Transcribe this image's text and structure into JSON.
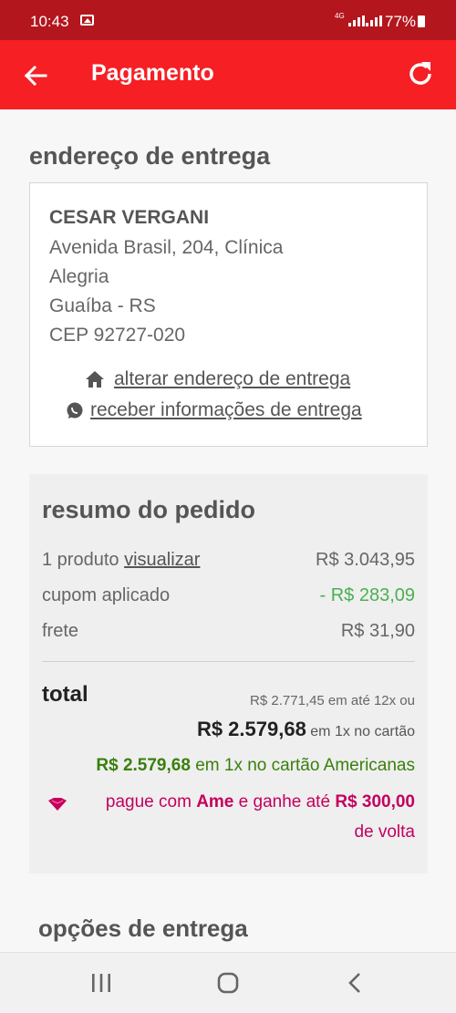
{
  "status_bar": {
    "time": "10:43",
    "network": "4G",
    "battery": "77%"
  },
  "app_bar": {
    "title": "Pagamento"
  },
  "delivery_address": {
    "section_title": "endereço de entrega",
    "name": "CESAR VERGANI",
    "lines": [
      "Avenida Brasil, 204, Clínica",
      "Alegria",
      "Guaíba - RS",
      "CEP 92727-020"
    ],
    "change_address_link": "alterar endereço de entrega",
    "delivery_info_link": "receber informações de entrega"
  },
  "order_summary": {
    "section_title": "resumo do pedido",
    "products_label": "1 produto",
    "view_link": "visualizar",
    "products_value": "R$ 3.043,95",
    "coupon_label": "cupom aplicado",
    "coupon_value": "- R$ 283,09",
    "shipping_label": "frete",
    "shipping_value": "R$ 31,90",
    "total_label": "total",
    "installments": "R$ 2.771,45 em até 12x ou",
    "total_amount": "R$ 2.579,68",
    "total_suffix": "em 1x no cartão",
    "americanas_amount": "R$ 2.579,68",
    "americanas_suffix": "em 1x no cartão Americanas",
    "ame_prefix": "pague com",
    "ame_brand": "Ame",
    "ame_middle": "e ganhe até",
    "ame_amount": "R$ 300,00",
    "ame_suffix": "de volta"
  },
  "delivery_options": {
    "section_title": "opções de entrega"
  },
  "colors": {
    "status_bar": "#b3161c",
    "app_bar": "#f51f24",
    "discount_green": "#4caf50",
    "americanas_green": "#3a7f0c",
    "ame_pink": "#c4005d"
  }
}
